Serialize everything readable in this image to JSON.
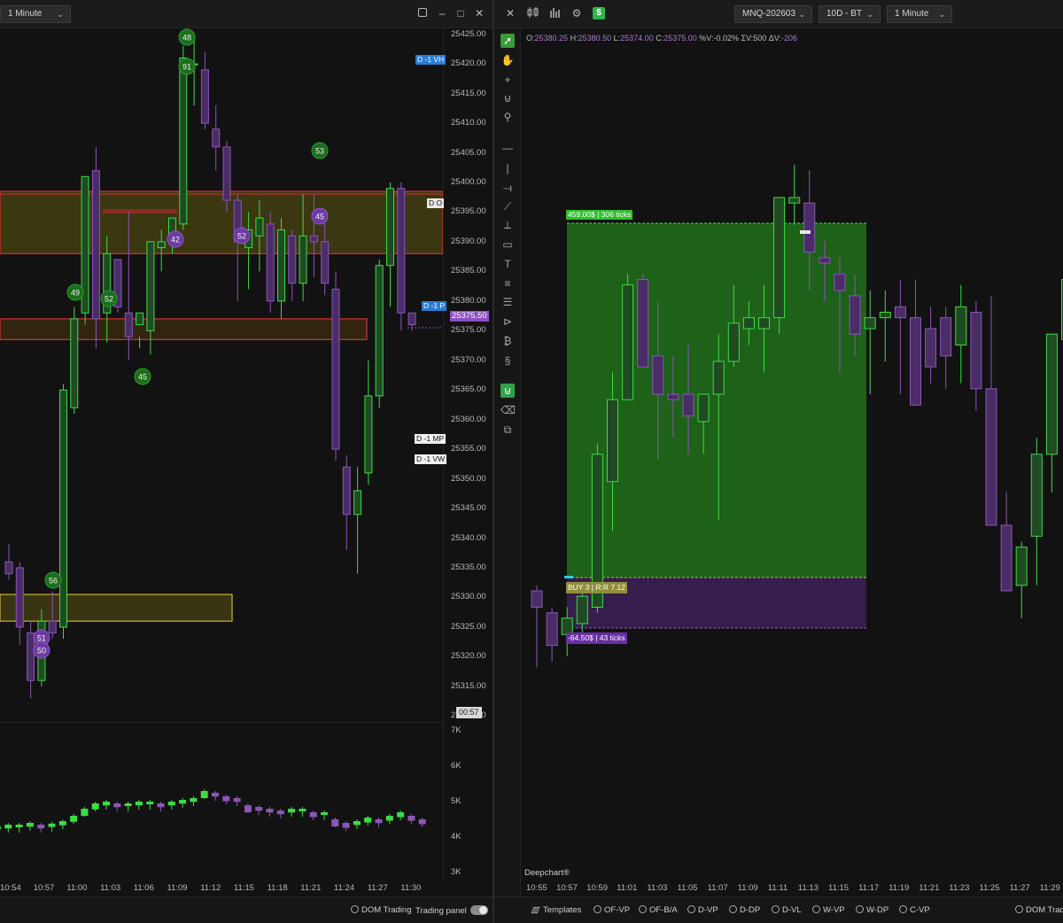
{
  "left": {
    "timeframe": "1 Minute",
    "window_controls": [
      "▢",
      "–",
      "□",
      "✕"
    ],
    "price_axis": [
      "25425.00",
      "25420.00",
      "25415.00",
      "25410.00",
      "25405.00",
      "25400.00",
      "25395.00",
      "25390.00",
      "25385.00",
      "25380.00",
      "25375.00",
      "25370.00",
      "25365.00",
      "25360.00",
      "25355.00",
      "25350.00",
      "25345.00",
      "25340.00",
      "25335.00",
      "25330.00",
      "25325.00",
      "25320.00",
      "25315.00",
      "25310.00"
    ],
    "current_price": "25375.50",
    "countdown": "00:57",
    "level_tags": [
      {
        "text": "D -1 VH",
        "style": "blue"
      },
      {
        "text": "D -1 P",
        "style": "blue"
      },
      {
        "text": "D -1 MP",
        "style": "white"
      },
      {
        "text": "D -1 VW",
        "style": "white"
      },
      {
        "text": "D O",
        "style": "white"
      }
    ],
    "bubbles": [
      {
        "num": "48",
        "color": "green"
      },
      {
        "num": "91",
        "color": "green"
      },
      {
        "num": "53",
        "color": "green"
      },
      {
        "num": "45",
        "color": "purple"
      },
      {
        "num": "42",
        "color": "purple"
      },
      {
        "num": "52",
        "color": "purple"
      },
      {
        "num": "49",
        "color": "green"
      },
      {
        "num": "52",
        "color": "green"
      },
      {
        "num": "45",
        "color": "green"
      },
      {
        "num": "56",
        "color": "green"
      },
      {
        "num": "51",
        "color": "purple"
      },
      {
        "num": "50",
        "color": "purple"
      }
    ],
    "volume_axis": [
      "7K",
      "6K",
      "5K",
      "4K",
      "3K"
    ],
    "time_axis": [
      "10:54",
      "10:57",
      "11:00",
      "11:03",
      "11:06",
      "11:09",
      "11:12",
      "11:15",
      "11:18",
      "11:21",
      "11:24",
      "11:27",
      "11:30"
    ],
    "dom_trading": "DOM Trading",
    "trading_panel": "Trading panel"
  },
  "right": {
    "symbol": "MNQ-202603",
    "data_range": "10D - BT",
    "timeframe": "1 Minute",
    "ohlc": {
      "o_label": "O:",
      "o": "25380.25",
      "h_label": "H:",
      "h": "25380.50",
      "l_label": "L:",
      "l": "25374.00",
      "c_label": "C:",
      "c": "25375.00",
      "pct_label": "%V:",
      "pct": "-0.02%",
      "sum_label": "ΣV:",
      "sum": "500",
      "dv_label": "ΔV:",
      "dv": "-206"
    },
    "target_label": "459.00$ | 306 ticks",
    "entry_label": "BUY 3 | R:R 7.12",
    "stop_label": "-64.50$ | 43 ticks",
    "watermark": "Deepchart®",
    "time_axis": [
      "10:55",
      "10:57",
      "10:59",
      "11:01",
      "11:03",
      "11:05",
      "11:07",
      "11:09",
      "11:11",
      "11:13",
      "11:15",
      "11:17",
      "11:19",
      "11:21",
      "11:23",
      "11:25",
      "11:27",
      "11:29"
    ],
    "templates": "Templates",
    "profiles": [
      "OF-VP",
      "OF-B/A",
      "D-VP",
      "D-DP",
      "D-VL",
      "W-VP",
      "W-DP",
      "C-VP"
    ],
    "dom_trading": "DOM Tradi"
  },
  "colors": {
    "bull": "#3ddc44",
    "bear": "#8a56b8",
    "bull_fill": "#1f4a22",
    "bear_fill": "#4a2d66",
    "target_zone": "#1f6b1a",
    "stop_zone": "#3a1f52",
    "price_tag": "#8e4fc4",
    "level_blue": "#2b7bd6"
  },
  "chart_data": {
    "type": "candlestick",
    "left_candles": [
      [
        25336,
        25339,
        25333,
        25334
      ],
      [
        25335,
        25336,
        25322,
        25325
      ],
      [
        25324,
        25326,
        25313,
        25316
      ],
      [
        25316,
        25328,
        25315,
        25326
      ],
      [
        25326,
        25331,
        25323,
        25324
      ],
      [
        25325,
        25366,
        25323,
        25365
      ],
      [
        25362,
        25379,
        25361,
        25377
      ],
      [
        25378,
        25400,
        25376,
        25401
      ],
      [
        25402,
        25406,
        25372,
        25377
      ],
      [
        25378,
        25391,
        25373,
        25388
      ],
      [
        25387,
        25380,
        25378,
        25379
      ],
      [
        25378,
        25395,
        25370,
        25374
      ],
      [
        25376,
        25374,
        25372,
        25378
      ],
      [
        25375,
        25390,
        25371,
        25390
      ],
      [
        25389,
        25392,
        25385,
        25390
      ],
      [
        25391,
        25394,
        25388,
        25394
      ],
      [
        25393,
        25423,
        25392,
        25421
      ],
      [
        25420,
        25425,
        25413,
        25420
      ],
      [
        25419,
        25422,
        25409,
        25410
      ],
      [
        25409,
        25413,
        25402,
        25406
      ],
      [
        25406,
        25407,
        25395,
        25397
      ],
      [
        25397,
        25398,
        25380,
        25390
      ],
      [
        25389,
        25395,
        25382,
        25392
      ],
      [
        25391,
        25397,
        25385,
        25394
      ],
      [
        25393,
        25395,
        25378,
        25380
      ],
      [
        25380,
        25394,
        25377,
        25392
      ],
      [
        25391,
        25392,
        25380,
        25383
      ],
      [
        25383,
        25398,
        25380,
        25391
      ],
      [
        25391,
        25398,
        25384,
        25390
      ],
      [
        25390,
        25395,
        25381,
        25383
      ],
      [
        25382,
        25385,
        25353,
        25355
      ],
      [
        25352,
        25354,
        25338,
        25344
      ],
      [
        25344,
        25352,
        25334,
        25348
      ],
      [
        25351,
        25370,
        25349,
        25364
      ],
      [
        25364,
        25387,
        25362,
        25386
      ],
      [
        25386,
        25400,
        25379,
        25399
      ],
      [
        25399,
        25400,
        25375,
        25378
      ],
      [
        25378,
        25378,
        25375,
        25376
      ]
    ],
    "right_candles": [
      [
        25330,
        25331,
        25316,
        25327
      ],
      [
        25326,
        25327,
        25317,
        25320
      ],
      [
        25322,
        25327,
        25318,
        25325
      ],
      [
        25324,
        25330,
        25321,
        25329
      ],
      [
        25327,
        25357,
        25326,
        25355
      ],
      [
        25350,
        25370,
        25341,
        25365
      ],
      [
        25365,
        25388,
        25365,
        25386
      ],
      [
        25387,
        25388,
        25373,
        25371
      ],
      [
        25373,
        25383,
        25354,
        25366
      ],
      [
        25366,
        25373,
        25358,
        25365
      ],
      [
        25366,
        25375,
        25355,
        25362
      ],
      [
        25361,
        25366,
        25355,
        25366
      ],
      [
        25366,
        25377,
        25343,
        25372
      ],
      [
        25372,
        25386,
        25371,
        25379
      ],
      [
        25378,
        25383,
        25375,
        25380
      ],
      [
        25378,
        25386,
        25370,
        25380
      ],
      [
        25380,
        25402,
        25377,
        25402
      ],
      [
        25401,
        25408,
        25397,
        25402
      ],
      [
        25401,
        25407,
        25385,
        25392
      ],
      [
        25391,
        25394,
        25383,
        25390
      ],
      [
        25388,
        25391,
        25370,
        25385
      ],
      [
        25384,
        25388,
        25373,
        25377
      ],
      [
        25378,
        25385,
        25366,
        25380
      ],
      [
        25380,
        25385,
        25372,
        25381
      ],
      [
        25382,
        25387,
        25366,
        25380
      ],
      [
        25380,
        25387,
        25365,
        25364
      ],
      [
        25378,
        25382,
        25368,
        25371
      ],
      [
        25380,
        25382,
        25367,
        25373
      ],
      [
        25375,
        25386,
        25368,
        25382
      ],
      [
        25381,
        25383,
        25363,
        25367
      ],
      [
        25367,
        25384,
        25343,
        25342
      ],
      [
        25342,
        25348,
        25333,
        25330
      ],
      [
        25331,
        25339,
        25325,
        25338
      ],
      [
        25340,
        25358,
        25331,
        25355
      ],
      [
        25355,
        25376,
        25348,
        25377
      ],
      [
        25376,
        25390,
        25374,
        25387
      ],
      [
        25387,
        25389,
        25369,
        25370
      ]
    ],
    "left_price_range": [
      25309,
      25426
    ],
    "right_price_range": [
      25300,
      25420
    ],
    "volume_range": [
      3000,
      7000
    ],
    "volume_bars": [
      4300,
      4350,
      4350,
      4400,
      4350,
      4380,
      4450,
      4600,
      4800,
      4950,
      5000,
      4950,
      4950,
      5000,
      5000,
      4950,
      5000,
      5050,
      5100,
      5300,
      5250,
      5150,
      5100,
      4900,
      4850,
      4800,
      4750,
      4800,
      4800,
      4700,
      4700,
      4500,
      4400,
      4450,
      4550,
      4500,
      4600,
      4700,
      4600,
      4500
    ]
  }
}
